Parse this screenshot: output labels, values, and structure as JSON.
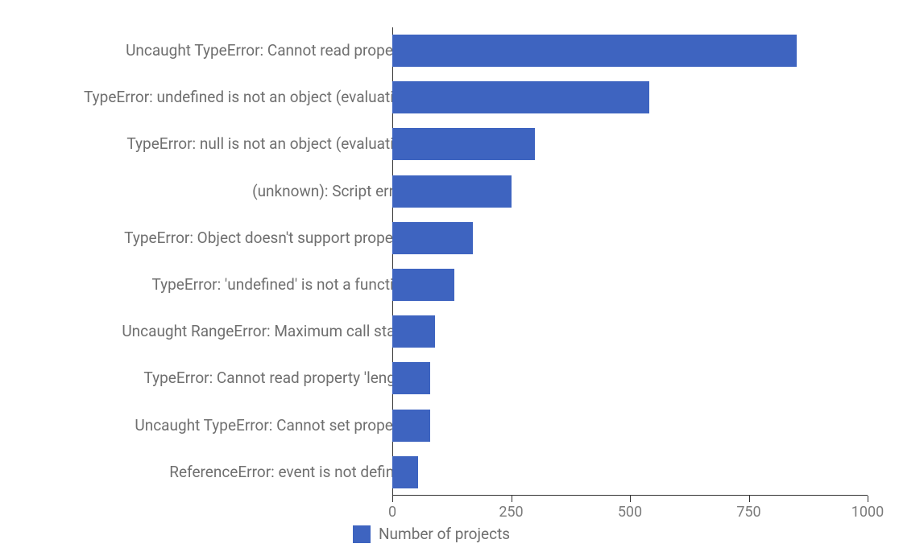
{
  "chart_data": {
    "type": "bar",
    "orientation": "horizontal",
    "categories": [
      "Uncaught TypeError: Cannot read property",
      "TypeError: undefined is not an object (evaluating",
      "TypeError: null is not an object (evaluating",
      "(unknown): Script error.",
      "TypeError: Object doesn't support property",
      "TypeError: 'undefined' is not a function",
      "Uncaught RangeError: Maximum call stack",
      "TypeError: Cannot read property 'length'",
      "Uncaught TypeError: Cannot set property",
      "ReferenceError: event is not defined"
    ],
    "series": [
      {
        "name": "Number of projects",
        "values": [
          850,
          540,
          300,
          250,
          170,
          130,
          90,
          80,
          80,
          55
        ]
      }
    ],
    "xlabel": "",
    "ylabel": "",
    "xlim": [
      0,
      1000
    ],
    "x_ticks": [
      0,
      250,
      500,
      750,
      1000
    ],
    "legend": {
      "position": "bottom",
      "items": [
        "Number of projects"
      ]
    },
    "colors": {
      "bar": "#3e64c0"
    }
  }
}
